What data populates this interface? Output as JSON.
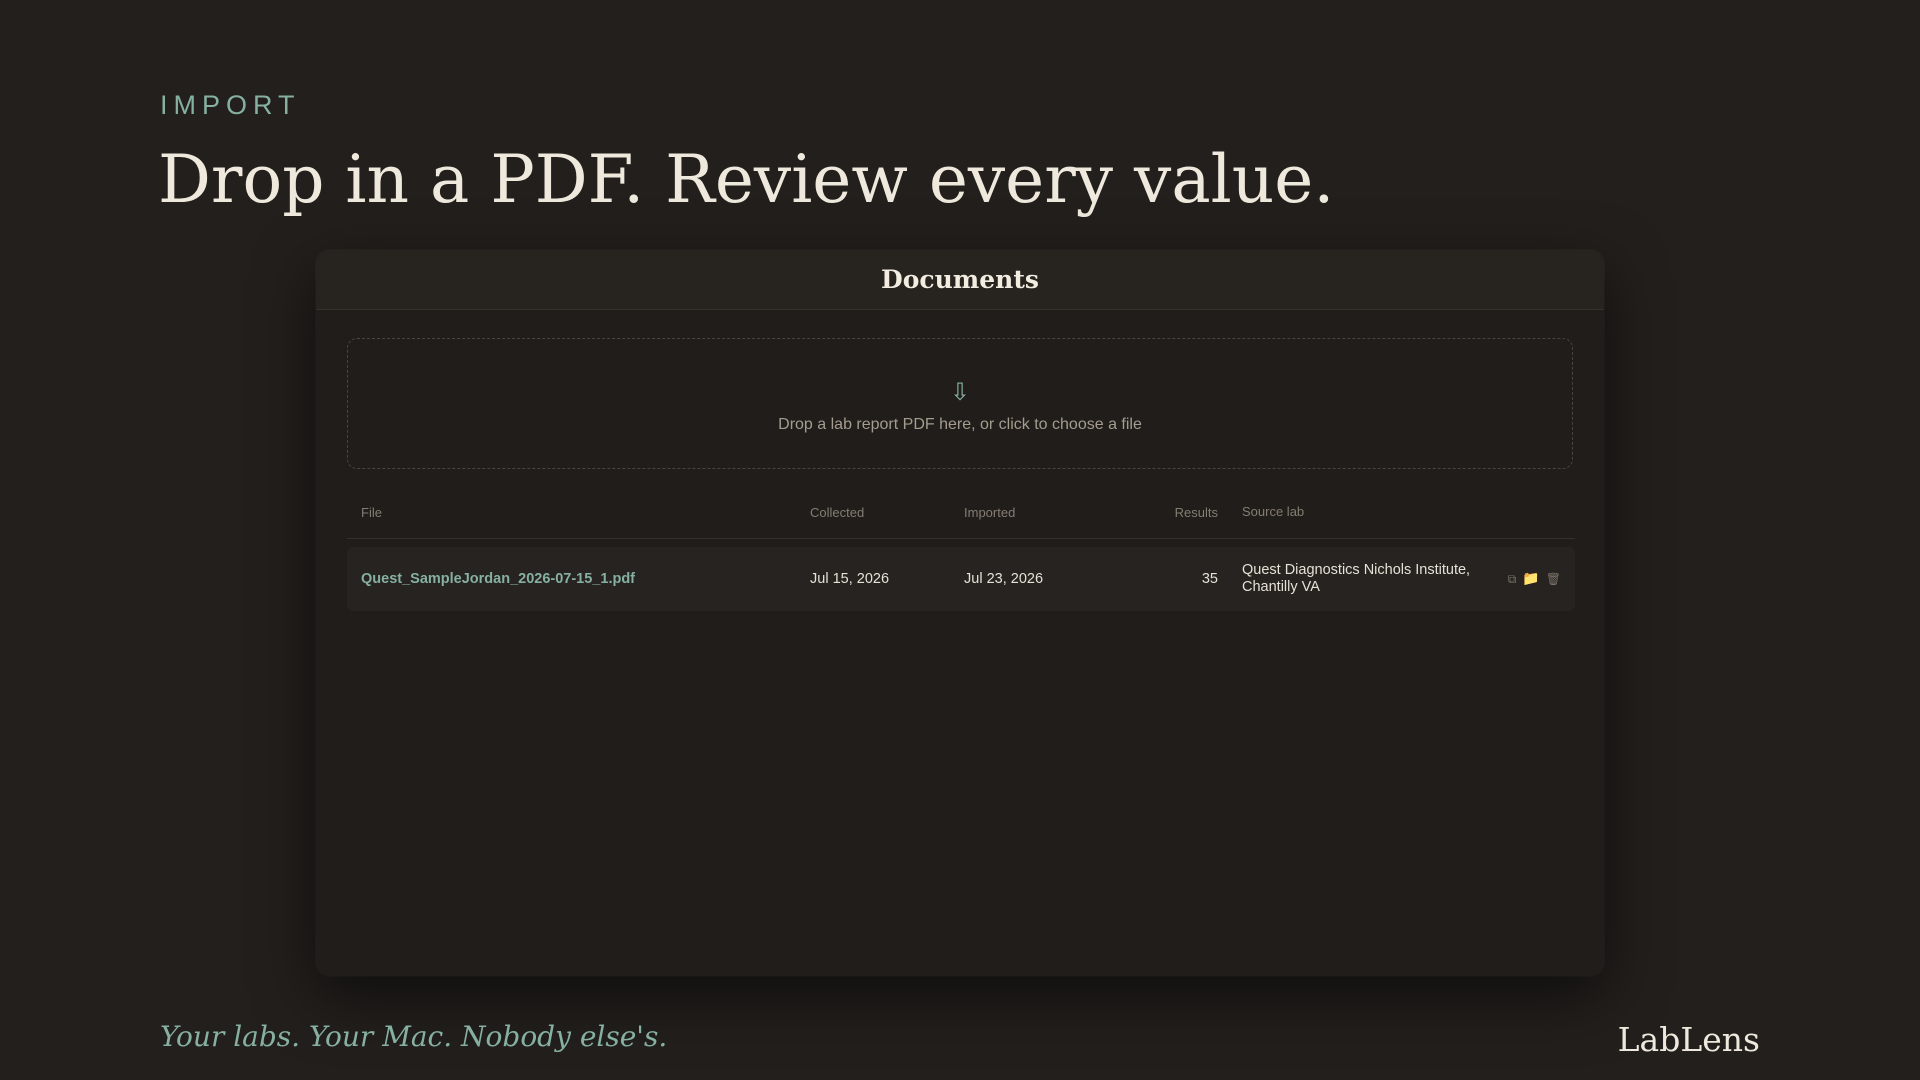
{
  "hero": {
    "eyebrow": "IMPORT",
    "headline": "Drop in a PDF. Review every value."
  },
  "window": {
    "title": "Documents",
    "dropzone": {
      "icon": "download-arrow-icon",
      "icon_glyph": "⇩",
      "text": "Drop a lab report PDF here, or click to choose a file"
    },
    "table": {
      "columns": {
        "file": "File",
        "collected": "Collected",
        "imported": "Imported",
        "results": "Results",
        "source_lab": "Source lab"
      },
      "rows": [
        {
          "file": "Quest_SampleJordan_2026-07-15_1.pdf",
          "collected": "Jul 15, 2026",
          "imported": "Jul 23, 2026",
          "results": "35",
          "source_lab_line1": "Quest Diagnostics Nichols Institute,",
          "source_lab_line2": "Chantilly VA",
          "actions": {
            "copy_icon": "copy-icon",
            "copy_glyph": "⧉",
            "folder_icon": "folder-icon",
            "folder_glyph": "📁",
            "trash_icon": "trash-icon",
            "trash_glyph": "🗑"
          }
        }
      ]
    }
  },
  "footer": {
    "tagline": "Your labs. Your Mac. Nobody else's.",
    "brand": "LabLens"
  },
  "colors": {
    "background": "#221f1c",
    "accent": "#86b0a0",
    "folder": "#e2b647",
    "text": "#efe9dd"
  }
}
